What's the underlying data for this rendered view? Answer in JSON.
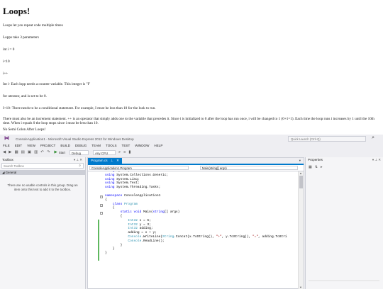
{
  "document": {
    "title": "Loops!",
    "paragraphs": [
      "Loops let you repeat code multiple times",
      "Lopps take 3 parameters",
      "int i = 0",
      "i<10",
      "i++",
      "Int i- Each lopp needs a counter variable. This integer is \"I\"",
      "for uterator, and is set to be 0.",
      "I<10- There needs to be a conditional statement. For example, I must be less than 10 for the look to run.",
      "There must also be an increment statement. ++ is an operator that simply adds one to the variable that precedes it. Since i is initialized to 0 after the loop has run once, i will be changed to 1 (0+1=1). Each time the loop runs i increases by 1 until the 10th time. When i equals 0 the loop stops since i must be less than 10.",
      "No Semi Colon After Loops!"
    ]
  },
  "vs": {
    "window_title": "ConsoleApplication1 - Microsoft Visual Studio Express 2012 for Windows Desktop",
    "quick_launch_placeholder": "Quick Launch (Ctrl+Q)",
    "menu": [
      "FILE",
      "EDIT",
      "VIEW",
      "PROJECT",
      "BUILD",
      "DEBUG",
      "TEAM",
      "TOOLS",
      "TEST",
      "WINDOW",
      "HELP"
    ],
    "toolbar": {
      "start_label": "Start",
      "config_value": "Debug",
      "platform_value": "Any CPU"
    },
    "toolbox": {
      "title": "Toolbox",
      "search_placeholder": "Search Toolbox",
      "group_label": "General",
      "empty_message": "There are no usable controls in this group. Drag an item onto this text to add it to the toolbox."
    },
    "editor": {
      "tab_label": "Program.cs",
      "nav_left": "ConsoleApplication1.Program",
      "nav_right": "Main(string[] args)"
    },
    "properties": {
      "title": "Properties"
    },
    "colors": {
      "accent": "#007acc",
      "keyword": "#0000ff",
      "type": "#2b91af",
      "string": "#a31515",
      "change_bar": "#5fb85f"
    }
  }
}
